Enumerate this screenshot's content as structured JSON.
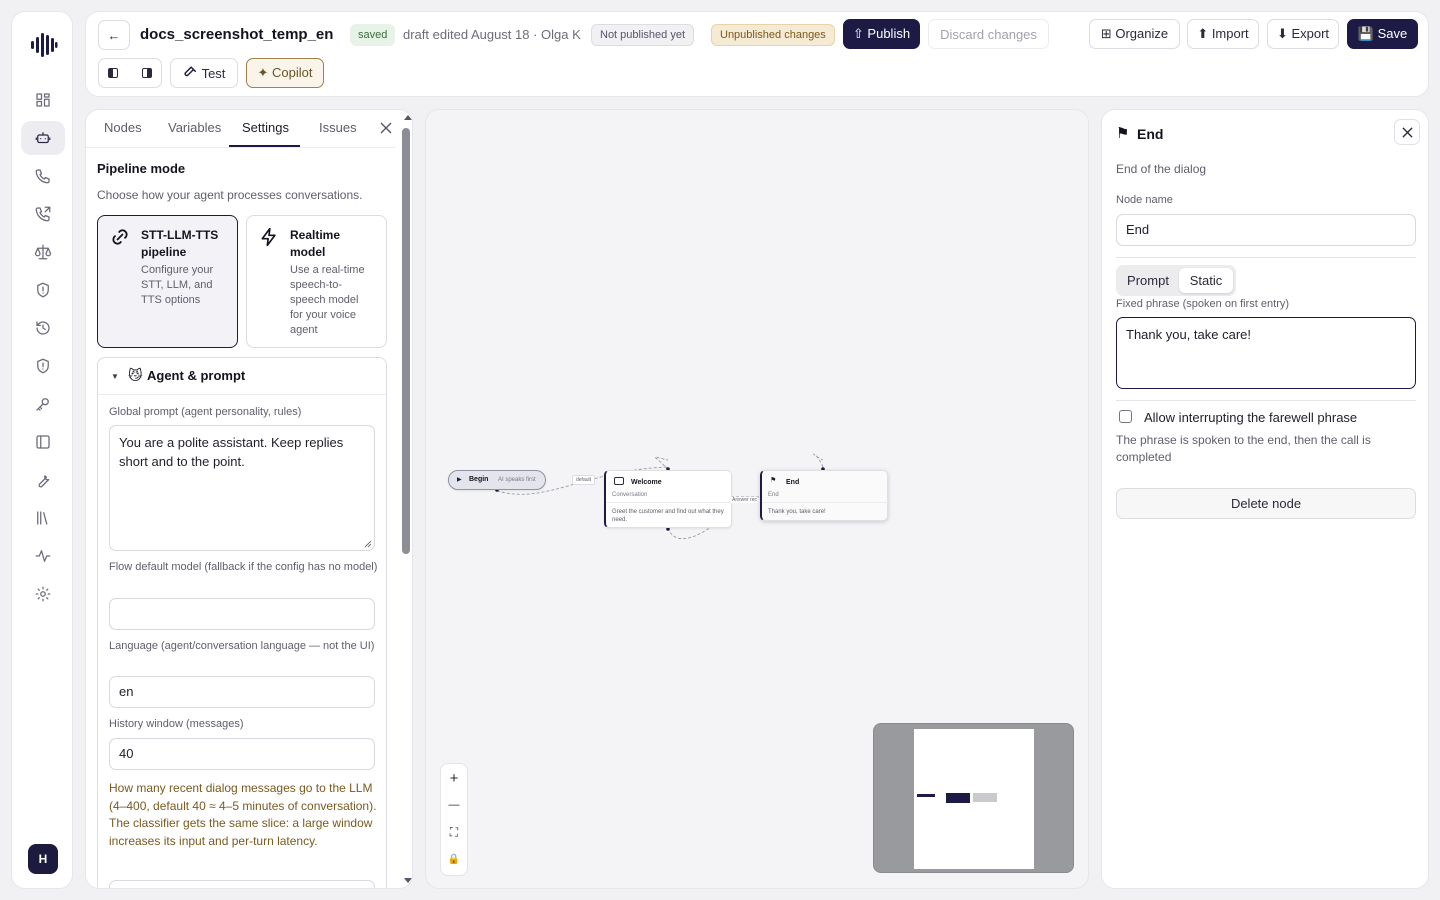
{
  "header": {
    "back_label": "←",
    "title": "docs_screenshot_temp_en",
    "saved_badge": "saved",
    "draft_info": "draft edited August 18 · Olga K",
    "not_published_badge": "Not published yet",
    "unpublished_changes_badge": "Unpublished changes",
    "publish_label": "⇧ Publish",
    "discard_label": "Discard changes",
    "organize_label": "⊞ Organize",
    "import_label": "⬆ Import",
    "export_label": "⬇ Export",
    "save_label": "💾 Save",
    "test_label": "Test",
    "copilot_label": "✦ Copilot"
  },
  "rail": {
    "avatar_initial": "H"
  },
  "settings": {
    "tabs": [
      "Nodes",
      "Variables",
      "Settings",
      "Issues"
    ],
    "active_tab": "Settings",
    "pipeline_title": "Pipeline mode",
    "pipeline_desc": "Choose how your agent processes conversations.",
    "options": [
      {
        "title_1": "STT-LLM-TTS",
        "title_2": "pipeline",
        "desc": [
          "Configure your",
          "STT, LLM, and",
          "TTS options"
        ],
        "selected": true
      },
      {
        "title_1": "Realtime",
        "title_2": "model",
        "desc": [
          "Use a real-time",
          "speech-to-",
          "speech model",
          "for your voice",
          "agent"
        ],
        "selected": false
      }
    ],
    "section_title": "Agent & prompt",
    "global_prompt_label": "Global prompt (agent personality, rules)",
    "global_prompt_value": "You are a polite assistant. Keep replies short and to the point.",
    "flow_model_label": "Flow default model (fallback if the config has no model)",
    "flow_model_value": "",
    "language_label": "Language (agent/conversation language — not the UI)",
    "language_value": "en",
    "history_label": "History window (messages)",
    "history_value": "40",
    "history_hint": "How many recent dialog messages go to the LLM (4–400, default 40 ≈ 4–5 minutes of conversation). The classifier gets the same slice: a large window increases its input and per-turn latency."
  },
  "canvas": {
    "begin_label": "Begin",
    "begin_sub": "AI speaks first",
    "edge_default": "default",
    "edge_answer": "Answer rec",
    "welcome_title": "Welcome",
    "welcome_type": "Conversation",
    "welcome_desc": "Greet the customer and find out what they need.",
    "end_title": "End",
    "end_type": "End",
    "end_desc": "Thank you, take care!",
    "zoom_in": "+",
    "zoom_out": "—",
    "fit": "⛶",
    "lock": "🔒"
  },
  "inspector": {
    "title": "End",
    "subtitle": "End of the dialog",
    "node_name_label": "Node name",
    "node_name_value": "End",
    "mode_tabs": [
      "Prompt",
      "Static"
    ],
    "active_mode": "Static",
    "fixed_phrase_label": "Fixed phrase (spoken on first entry)",
    "fixed_phrase_value": "Thank you, take care!",
    "allow_interrupt_label": "Allow interrupting the farewell phrase",
    "allow_interrupt_checked": false,
    "allow_interrupt_hint": "The phrase is spoken to the end, then the call is completed",
    "delete_label": "Delete node"
  },
  "colors": {
    "brand_dark": "#1d1b45",
    "saved_badge_bg": "#e8f3e8",
    "unpublished_badge_bg": "#f5ead4",
    "hint_text": "#7a5a1e"
  }
}
